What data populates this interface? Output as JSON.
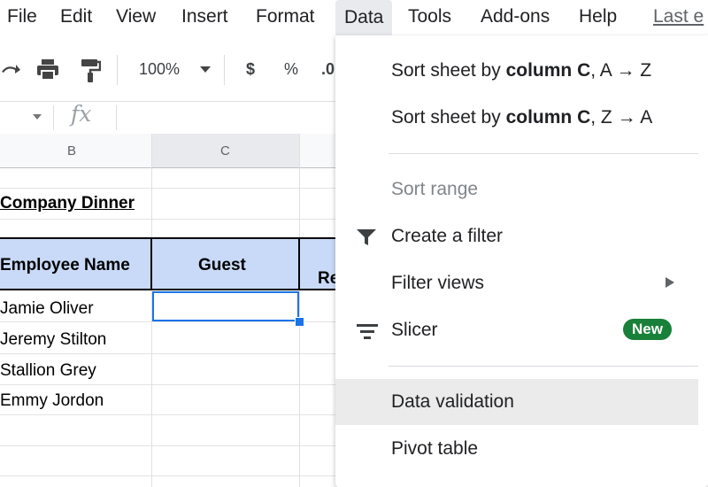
{
  "menubar": {
    "items": [
      "File",
      "Edit",
      "View",
      "Insert",
      "Format",
      "Data",
      "Tools",
      "Add-ons",
      "Help"
    ],
    "last_edit": "Last e"
  },
  "toolbar": {
    "zoom": "100%",
    "currency": "$",
    "percent": "%",
    "decimal": ".0"
  },
  "formula_bar": {
    "fx": "fx"
  },
  "sheet": {
    "columns": [
      "B",
      "C"
    ],
    "title": "Company Dinner",
    "headers": {
      "employee": "Employee Name",
      "guest": "Guest",
      "partial": "Re"
    },
    "employees": [
      "Jamie Oliver",
      "Jeremy Stilton",
      "Stallion Grey",
      "Emmy Jordon"
    ]
  },
  "data_menu": {
    "sort_az_prefix": "Sort sheet by ",
    "sort_az_bold": "column C",
    "sort_az_suffix": ", A → Z",
    "sort_za_prefix": "Sort sheet by ",
    "sort_za_bold": "column C",
    "sort_za_suffix": ", Z → A",
    "sort_range": "Sort range",
    "create_filter": "Create a filter",
    "filter_views": "Filter views",
    "slicer": "Slicer",
    "new_badge": "New",
    "data_validation": "Data validation",
    "pivot_table": "Pivot table"
  },
  "colors": {
    "header_fill": "#c9daf8",
    "selection": "#1a73e8",
    "badge": "#188038",
    "hover": "#e8eaed"
  }
}
